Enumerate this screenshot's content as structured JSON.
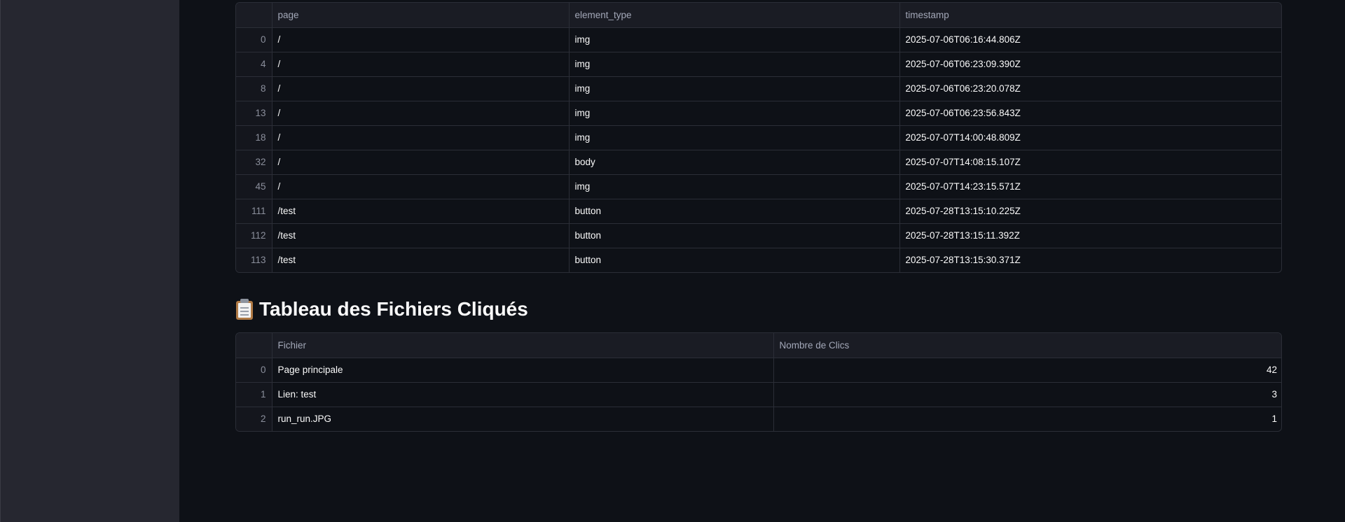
{
  "clicks_table": {
    "columns": [
      "page",
      "element_type",
      "timestamp"
    ],
    "rows": [
      {
        "index": "0",
        "page": "/",
        "element_type": "img",
        "timestamp": "2025-07-06T06:16:44.806Z"
      },
      {
        "index": "4",
        "page": "/",
        "element_type": "img",
        "timestamp": "2025-07-06T06:23:09.390Z"
      },
      {
        "index": "8",
        "page": "/",
        "element_type": "img",
        "timestamp": "2025-07-06T06:23:20.078Z"
      },
      {
        "index": "13",
        "page": "/",
        "element_type": "img",
        "timestamp": "2025-07-06T06:23:56.843Z"
      },
      {
        "index": "18",
        "page": "/",
        "element_type": "img",
        "timestamp": "2025-07-07T14:00:48.809Z"
      },
      {
        "index": "32",
        "page": "/",
        "element_type": "body",
        "timestamp": "2025-07-07T14:08:15.107Z"
      },
      {
        "index": "45",
        "page": "/",
        "element_type": "img",
        "timestamp": "2025-07-07T14:23:15.571Z"
      },
      {
        "index": "111",
        "page": "/test",
        "element_type": "button",
        "timestamp": "2025-07-28T13:15:10.225Z"
      },
      {
        "index": "112",
        "page": "/test",
        "element_type": "button",
        "timestamp": "2025-07-28T13:15:11.392Z"
      },
      {
        "index": "113",
        "page": "/test",
        "element_type": "button",
        "timestamp": "2025-07-28T13:15:30.371Z"
      }
    ]
  },
  "files_section": {
    "icon": "clipboard-icon",
    "title": "Tableau des Fichiers Cliqués"
  },
  "files_table": {
    "columns": [
      "Fichier",
      "Nombre de Clics"
    ],
    "rows": [
      {
        "index": "0",
        "file": "Page principale",
        "clicks": "42"
      },
      {
        "index": "1",
        "file": "Lien: test",
        "clicks": "3"
      },
      {
        "index": "2",
        "file": "run_run.JPG",
        "clicks": "1"
      }
    ]
  },
  "colors": {
    "background": "#0e1117",
    "sidebar": "#262730",
    "header": "#1a1c24",
    "border": "#2b2e37"
  }
}
